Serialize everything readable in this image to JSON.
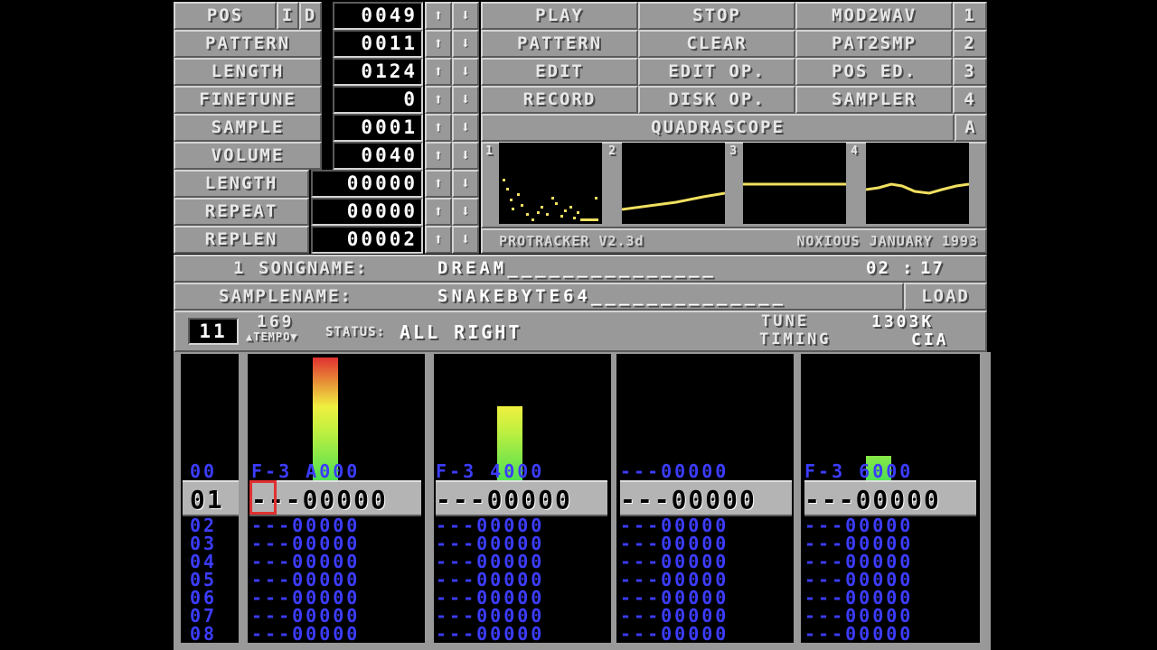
{
  "controls": {
    "pos": {
      "label": "POS",
      "value": "0049"
    },
    "i_btn": "I",
    "d_btn": "D",
    "pattern": {
      "label": "PATTERN",
      "value": "0011"
    },
    "length": {
      "label": "LENGTH",
      "value": "0124"
    },
    "finetune": {
      "label": "FINETUNE",
      "value": "0"
    },
    "sample": {
      "label": "SAMPLE",
      "value": "0001"
    },
    "volume": {
      "label": "VOLUME",
      "value": "0040"
    },
    "s_length": {
      "label": "LENGTH",
      "value": "00000"
    },
    "repeat": {
      "label": "REPEAT",
      "value": "00000"
    },
    "replen": {
      "label": "REPLEN",
      "value": "00002"
    },
    "up_arrow": "⬆",
    "down_arrow": "⬇"
  },
  "menu": {
    "play": "PLAY",
    "stop": "STOP",
    "mod2wav": "MOD2WAV",
    "k1": "1",
    "pattern": "PATTERN",
    "clear": "CLEAR",
    "pat2smp": "PAT2SMP",
    "k2": "2",
    "edit": "EDIT",
    "edit_op": "EDIT OP.",
    "pos_ed": "POS ED.",
    "k3": "3",
    "record": "RECORD",
    "disk_op": "DISK OP.",
    "sampler": "SAMPLER",
    "k4": "4",
    "quadrascope": "QUADRASCOPE",
    "ka": "A"
  },
  "scopes": {
    "n1": "1",
    "n2": "2",
    "n3": "3",
    "n4": "4",
    "ink": "#f0e060"
  },
  "footer": {
    "version": "PROTRACKER V2.3d",
    "credit": "NOXIOUS JANUARY 1993"
  },
  "song": {
    "num": "1",
    "label": "SONGNAME:",
    "name": "DREAM_______________",
    "time_m": "02",
    "time_s": "17"
  },
  "samplename": {
    "label": "SAMPLENAME:",
    "name": "SNAKEBYTE64______________",
    "load": "LOAD"
  },
  "status": {
    "pattern": "11",
    "tempo": "169",
    "tempo_label": "▲TEMPO▼",
    "status_label": "STATUS:",
    "status": "ALL RIGHT",
    "tune_label": "TUNE",
    "tune_value": "1303K",
    "timing_label": "TIMING",
    "timing_value": "CIA"
  },
  "rows": {
    "numbers": [
      "00",
      "01",
      "02",
      "03",
      "04",
      "05",
      "06",
      "07",
      "08"
    ],
    "ch1": [
      "F-3 A000",
      "---00000",
      "---00000",
      "---00000",
      "---00000",
      "---00000",
      "---00000",
      "---00000",
      "---00000"
    ],
    "ch2": [
      "F-3 4000",
      "---00000",
      "---00000",
      "---00000",
      "---00000",
      "---00000",
      "---00000",
      "---00000",
      "---00000"
    ],
    "ch3": [
      "---00000",
      "---00000",
      "---00000",
      "---00000",
      "---00000",
      "---00000",
      "---00000",
      "---00000",
      "---00000"
    ],
    "ch4": [
      "F-3 6000",
      "---00000",
      "---00000",
      "---00000",
      "---00000",
      "---00000",
      "---00000",
      "---00000",
      "---00000"
    ]
  },
  "vu": {
    "ch1": 1.0,
    "ch2": 0.6,
    "ch3": 0.0,
    "ch4": 0.2
  }
}
